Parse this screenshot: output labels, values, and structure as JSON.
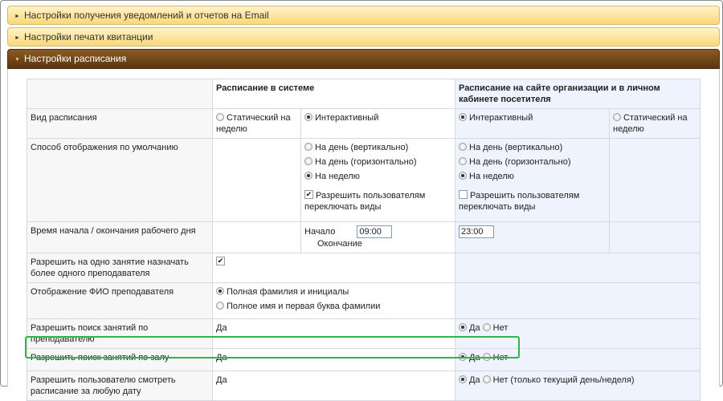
{
  "accordion": [
    {
      "title": "Настройки получения уведомлений и отчетов на Email",
      "open": false
    },
    {
      "title": "Настройки печати квитанции",
      "open": false
    },
    {
      "title": "Настройки расписания",
      "open": true
    }
  ],
  "table": {
    "header": {
      "system": "Расписание в системе",
      "site": "Расписание на сайте организации и в личном кабинете посетителя"
    },
    "rows": {
      "view": {
        "label": "Вид расписания",
        "sys_static": "Статический на неделю",
        "sys_interactive": "Интерактивный",
        "site_interactive": "Интерактивный",
        "site_static": "Статический на неделю"
      },
      "display": {
        "label": "Способ отображения по умолчанию",
        "sys_opts": [
          "На день (вертикально)",
          "На день (горизонтально)",
          "На неделю"
        ],
        "sys_allow": "Разрешить пользователям переключать виды",
        "site_opts": [
          "На день (вертикально)",
          "На день (горизонтально)",
          "На неделю"
        ],
        "site_allow": "Разрешить пользователям переключать виды"
      },
      "time": {
        "label": "Время начала / окончания рабочего дня",
        "start_label": "Начало",
        "start_value": "09:00",
        "end_label": "Окончание",
        "end_value": "23:00"
      },
      "multi_teacher": {
        "label": "Разрешить на одно занятие назначать более одного преподавателя"
      },
      "teacher_name": {
        "label": "Отображение ФИО преподавателя",
        "opt_full": "Полная фамилия и инициалы",
        "opt_short": "Полное имя и первая буква фамилии"
      },
      "search_teacher": {
        "label": "Разрешить поиск занятий по преподавателю",
        "sys_value": "Да",
        "yes": "Да",
        "no": "Нет"
      },
      "search_hall": {
        "label": "Разрешить поиск занятий по залу",
        "sys_value": "Да",
        "yes": "Да",
        "no": "Нет"
      },
      "any_date": {
        "label": "Разрешить пользователю смотреть расписание за любую дату",
        "sys_value": "Да",
        "yes": "Да",
        "no": "Нет (только текущий день/неделя)"
      }
    }
  }
}
